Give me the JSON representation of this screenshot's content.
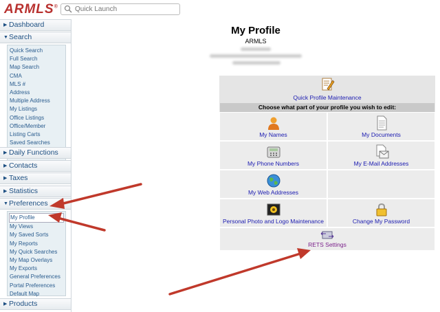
{
  "header": {
    "logo": "ARMLS",
    "logo_mark": "®",
    "search_placeholder": "Quick Launch"
  },
  "sidebar": {
    "dashboard": "Dashboard",
    "search": "Search",
    "search_items": [
      "Quick Search",
      "Full Search",
      "Map Search",
      "CMA",
      "MLS #",
      "Address",
      "Multiple Address",
      "My Listings",
      "Office Listings",
      "Office/Member",
      "Listing Carts",
      "Saved Searches"
    ],
    "daily_functions": "Daily Functions",
    "contacts": "Contacts",
    "taxes": "Taxes",
    "statistics": "Statistics",
    "preferences": "Preferences",
    "preference_items": [
      "My Profile",
      "My Views",
      "My Saved Sorts",
      "My Reports",
      "My Quick Searches",
      "My Map Overlays",
      "My Exports",
      "General Preferences",
      "Portal Preferences",
      "Default Map"
    ],
    "products": "Products"
  },
  "main": {
    "title": "My Profile",
    "org": "ARMLS",
    "quick_profile": "Quick Profile Maintenance",
    "choose": "Choose what part of your profile you wish to edit:",
    "options": {
      "names": "My Names",
      "documents": "My Documents",
      "phones": "My Phone Numbers",
      "emails": "My E-Mail Addresses",
      "web": "My Web Addresses",
      "photo": "Personal Photo and Logo Maintenance",
      "password": "Change My Password",
      "rets": "RETS Settings"
    }
  },
  "colors": {
    "arrow": "#c0392b",
    "link": "#1a1ab0",
    "sidebar_text": "#1d4f82"
  }
}
